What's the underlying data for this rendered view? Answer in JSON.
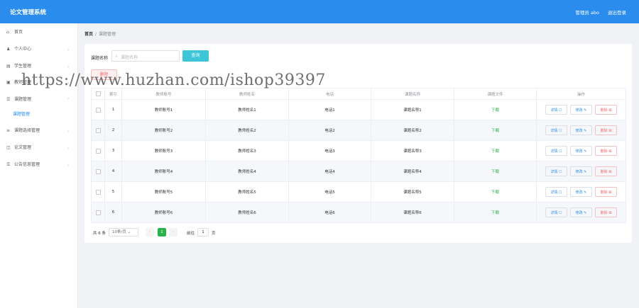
{
  "header": {
    "title": "论文管理系统",
    "user": "管理员 abo",
    "logout": "退出登录"
  },
  "sidebar": {
    "items": [
      {
        "icon": "⌂",
        "label": "首页",
        "chev": ""
      },
      {
        "icon": "♟",
        "label": "个人中心",
        "chev": "⌄"
      },
      {
        "icon": "▤",
        "label": "学生管理",
        "chev": "⌄"
      },
      {
        "icon": "▣",
        "label": "教师管理",
        "chev": "⌄"
      },
      {
        "icon": "☰",
        "label": "课题管理",
        "chev": "⌃"
      },
      {
        "icon": "",
        "label": "课题管理",
        "chev": ""
      },
      {
        "icon": "≡",
        "label": "课题选择管理",
        "chev": "⌄"
      },
      {
        "icon": "◫",
        "label": "论文管理",
        "chev": "⌄"
      },
      {
        "icon": "☰",
        "label": "公告信息管理",
        "chev": "⌄"
      }
    ]
  },
  "breadcrumb": {
    "home": "首页",
    "sep": "/",
    "current": "课题管理"
  },
  "search": {
    "label": "课题名称",
    "placeholder": "课题名称",
    "button": "查询",
    "icon": "⌕"
  },
  "actions": {
    "delete": "删除"
  },
  "table": {
    "headers": [
      "",
      "索引",
      "教师账号",
      "教师姓名",
      "电话",
      "课题名称",
      "课题文件",
      "操作"
    ],
    "rows": [
      [
        "1",
        "教师账号1",
        "教师姓名1",
        "电话1",
        "课题名称1",
        "下载"
      ],
      [
        "2",
        "教师账号2",
        "教师姓名2",
        "电话2",
        "课题名称2",
        "下载"
      ],
      [
        "3",
        "教师账号3",
        "教师姓名3",
        "电话3",
        "课题名称3",
        "下载"
      ],
      [
        "4",
        "教师账号4",
        "教师姓名4",
        "电话4",
        "课题名称4",
        "下载"
      ],
      [
        "5",
        "教师账号5",
        "教师姓名5",
        "电话5",
        "课题名称5",
        "下载"
      ],
      [
        "6",
        "教师账号6",
        "教师姓名6",
        "电话6",
        "课题名称6",
        "下载"
      ]
    ],
    "ops": {
      "detail": "详情 ☐",
      "edit": "修改 ✎",
      "remove": "删除 ⊠"
    }
  },
  "pager": {
    "total": "共 6 条",
    "size": "10条/页 ⌄",
    "prev": "‹",
    "page": "1",
    "next": "›",
    "goto": "前往",
    "goto_value": "1",
    "page_unit": "页"
  },
  "watermark": "https://www.huzhan.com/ishop39397"
}
